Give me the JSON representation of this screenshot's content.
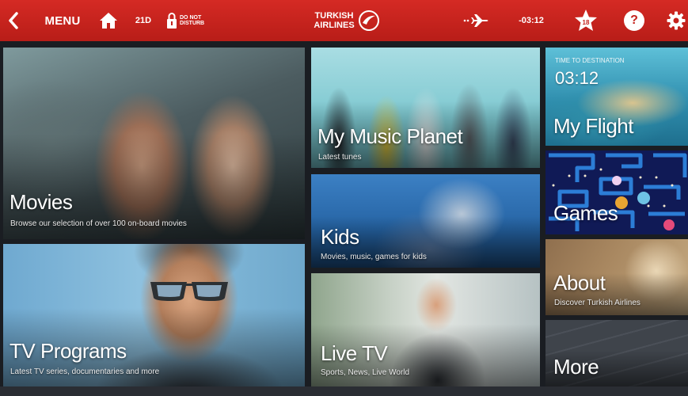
{
  "topbar": {
    "back_icon": "chevron-left-icon",
    "menu_label": "MENU",
    "home_icon": "home-icon",
    "seat": "21D",
    "dnd_icon": "lock-icon",
    "dnd_label": "DO NOT DISTURB",
    "logo_line1": "TURKISH",
    "logo_line2": "AIRLINES",
    "logo_icon": "turkish-airlines-logo",
    "flight_icon": "airplane-icon",
    "time_remaining": "-03:12",
    "star_icon": "star-icon",
    "star_label": "18",
    "help_label": "?",
    "settings_icon": "gear-icon",
    "color": "#c4211c"
  },
  "tiles": {
    "movies": {
      "title": "Movies",
      "subtitle": "Browse our selection of over 100 on-board movies"
    },
    "music": {
      "title": "My Music Planet",
      "subtitle": "Latest tunes"
    },
    "flight": {
      "caption": "TIME TO DESTINATION",
      "time": "03:12",
      "title": "My Flight"
    },
    "kids": {
      "title": "Kids",
      "subtitle": "Movies, music, games for kids"
    },
    "games": {
      "title": "Games"
    },
    "tv": {
      "title": "TV Programs",
      "subtitle": "Latest TV series, documentaries and more"
    },
    "livetv": {
      "title": "Live TV",
      "subtitle": "Sports, News, Live World"
    },
    "about": {
      "title": "About",
      "subtitle": "Discover Turkish Airlines"
    },
    "more": {
      "title": "More"
    }
  }
}
